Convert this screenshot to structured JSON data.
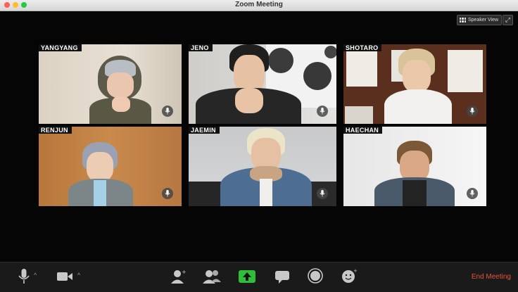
{
  "window": {
    "title": "Zoom Meeting"
  },
  "view_controls": {
    "speaker_view_label": "Speaker View"
  },
  "participants": [
    {
      "name": "YANGYANG"
    },
    {
      "name": "JENO"
    },
    {
      "name": "SHOTARO"
    },
    {
      "name": "RENJUN"
    },
    {
      "name": "JAEMIN"
    },
    {
      "name": "HAECHAN"
    }
  ],
  "toolbar": {
    "end_meeting_label": "End Meeting"
  },
  "colors": {
    "end_meeting": "#e5533d",
    "share_button": "#2fbe3a",
    "toolbar_bg": "#1a1a1a"
  }
}
